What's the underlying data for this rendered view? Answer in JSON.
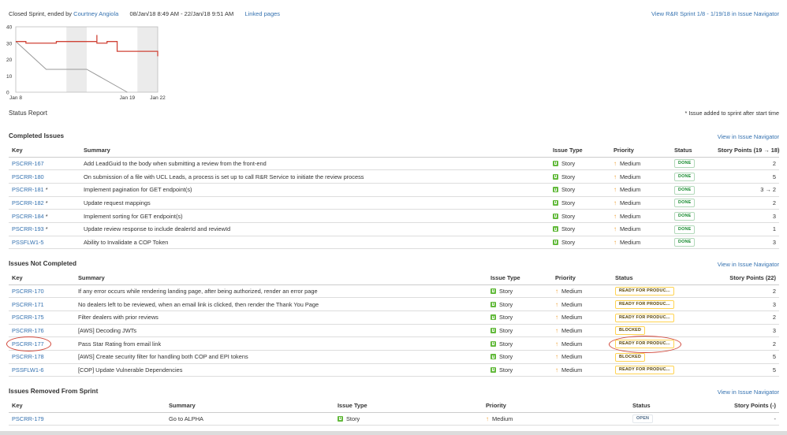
{
  "header": {
    "sprint_status": "Closed Sprint, ended by",
    "ended_by": "Courtney Angiola",
    "date_range": "08/Jan/18 8:49 AM - 22/Jan/18 9:51 AM",
    "linked_pages": "Linked pages",
    "navigator_link": "View R&R Sprint 1/8 - 1/19/18 in Issue Navigator"
  },
  "burndown": {
    "y_ticks": [
      "40",
      "30",
      "20",
      "10",
      "0"
    ],
    "x_ticks": [
      "Jan 8",
      "Jan 19",
      "Jan 22"
    ],
    "colors": {
      "remaining": "#d04437",
      "guideline": "#999999",
      "nonworking": "#ebebeb"
    }
  },
  "chart_data": {
    "type": "line",
    "title": "",
    "xlabel": "",
    "ylabel": "",
    "ylim": [
      0,
      40
    ],
    "x_ticks": [
      "Jan 8",
      "Jan 19",
      "Jan 22"
    ],
    "series": [
      {
        "x": [
          "2018-01-08",
          "2018-01-09",
          "2018-01-09",
          "2018-01-12",
          "2018-01-12",
          "2018-01-16",
          "2018-01-16",
          "2018-01-16",
          "2018-01-17",
          "2018-01-17",
          "2018-01-18",
          "2018-01-18",
          "2018-01-22",
          "2018-01-22"
        ],
        "y": [
          31,
          31,
          30,
          30,
          31,
          31,
          35,
          30,
          30,
          31,
          31,
          25,
          25,
          22
        ]
      },
      {
        "x": [
          "2018-01-08",
          "2018-01-11",
          "2018-01-15",
          "2018-01-19"
        ],
        "y": [
          31,
          14,
          14,
          0
        ]
      }
    ],
    "nonworking_ranges": [
      [
        "2018-01-13",
        "2018-01-15"
      ],
      [
        "2018-01-20",
        "2018-01-22"
      ]
    ],
    "grid": false
  },
  "status_report": "Status Report",
  "added_note": "* Issue added to sprint after start time",
  "completed": {
    "title": "Completed Issues",
    "link": "View in Issue Navigator",
    "headers": {
      "key": "Key",
      "summary": "Summary",
      "type": "Issue Type",
      "priority": "Priority",
      "status": "Status",
      "points": "Story Points (19 → 18)"
    },
    "rows": [
      {
        "key": "PSCRR-167",
        "star": "",
        "summary": "Add LeadGuid to the body when submitting a review from the front-end",
        "type": "Story",
        "priority": "Medium",
        "status": "DONE",
        "points": "2"
      },
      {
        "key": "PSCRR-180",
        "star": "",
        "summary": "On submission of a file with UCL Leads, a process is set up to call R&R Service to initiate the review process",
        "type": "Story",
        "priority": "Medium",
        "status": "DONE",
        "points": "5"
      },
      {
        "key": "PSCRR-181",
        "star": "*",
        "summary": "Implement pagination for GET endpoint(s)",
        "type": "Story",
        "priority": "Medium",
        "status": "DONE",
        "points": "3 → 2"
      },
      {
        "key": "PSCRR-182",
        "star": "*",
        "summary": "Update request mappings",
        "type": "Story",
        "priority": "Medium",
        "status": "DONE",
        "points": "2"
      },
      {
        "key": "PSCRR-184",
        "star": "*",
        "summary": "Implement sorting for GET endpoint(s)",
        "type": "Story",
        "priority": "Medium",
        "status": "DONE",
        "points": "3"
      },
      {
        "key": "PSCRR-193",
        "star": "*",
        "summary": "Update review response to include dealerId and reviewId",
        "type": "Story",
        "priority": "Medium",
        "status": "DONE",
        "points": "1"
      },
      {
        "key": "PSSFLW1-5",
        "star": "",
        "summary": "Ability to Invalidate a COP Token",
        "type": "Story",
        "priority": "Medium",
        "status": "DONE",
        "points": "3"
      }
    ]
  },
  "not_completed": {
    "title": "Issues Not Completed",
    "link": "View in Issue Navigator",
    "headers": {
      "key": "Key",
      "summary": "Summary",
      "type": "Issue Type",
      "priority": "Priority",
      "status": "Status",
      "points": "Story Points (22)"
    },
    "rows": [
      {
        "key": "PSCRR-170",
        "summary": "If any error occurs while rendering landing page, after being authorized, render an error page",
        "type": "Story",
        "priority": "Medium",
        "status": "READY FOR PRODUC...",
        "points": "2"
      },
      {
        "key": "PSCRR-171",
        "summary": "No dealers left to be reviewed, when an email link is clicked, then render the Thank You Page",
        "type": "Story",
        "priority": "Medium",
        "status": "READY FOR PRODUC...",
        "points": "3"
      },
      {
        "key": "PSCRR-175",
        "summary": "Filter dealers with prior reviews",
        "type": "Story",
        "priority": "Medium",
        "status": "READY FOR PRODUC...",
        "points": "2"
      },
      {
        "key": "PSCRR-176",
        "summary": "[AWS] Decoding JWTs",
        "type": "Story",
        "priority": "Medium",
        "status": "BLOCKED",
        "points": "3"
      },
      {
        "key": "PSCRR-177",
        "summary": "Pass Star Rating from email link",
        "type": "Story",
        "priority": "Medium",
        "status": "READY FOR PRODUC...",
        "points": "2"
      },
      {
        "key": "PSCRR-178",
        "summary": "[AWS] Create security filter for handling both COP and EPI tokens",
        "type": "Story",
        "priority": "Medium",
        "status": "BLOCKED",
        "points": "5"
      },
      {
        "key": "PSSFLW1-6",
        "summary": "[COP] Update Vulnerable Dependencies",
        "type": "Story",
        "priority": "Medium",
        "status": "READY FOR PRODUC...",
        "points": "5"
      }
    ]
  },
  "removed": {
    "title": "Issues Removed From Sprint",
    "link": "View in Issue Navigator",
    "headers": {
      "key": "Key",
      "summary": "Summary",
      "type": "Issue Type",
      "priority": "Priority",
      "status": "Status",
      "points": "Story Points (-)"
    },
    "rows": [
      {
        "key": "PSCRR-179",
        "summary": "Go to ALPHA",
        "type": "Story",
        "priority": "Medium",
        "status": "OPEN",
        "points": "-"
      }
    ]
  }
}
